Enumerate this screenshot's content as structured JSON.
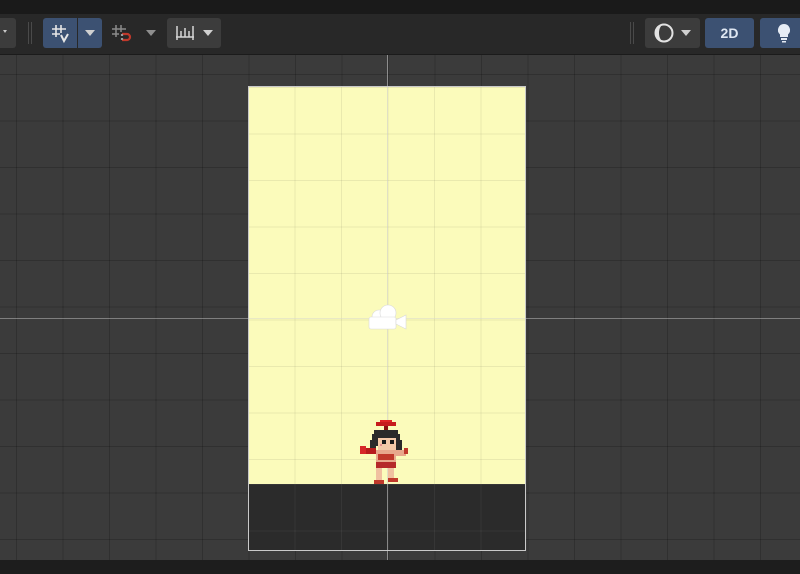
{
  "toolbar": {
    "two_d_label": "2D",
    "grid_snap": {
      "icon": "grid-snapping-icon",
      "active": true
    },
    "increment_snap": {
      "icon": "increment-snap-icon",
      "active": false
    },
    "ruler": {
      "icon": "ruler-icon"
    },
    "shading": {
      "icon": "shading-mode-icon"
    },
    "lighting": {
      "icon": "lightbulb-icon"
    }
  },
  "scene": {
    "camera_gizmo": "camera-gizmo-icon",
    "player_sprite": "player-character-sprite"
  },
  "colors": {
    "active_button": "#3c5172",
    "camera_background": "#fbfbbb",
    "ground": "#2b2b2b",
    "grid_background": "#3b3b3b"
  }
}
